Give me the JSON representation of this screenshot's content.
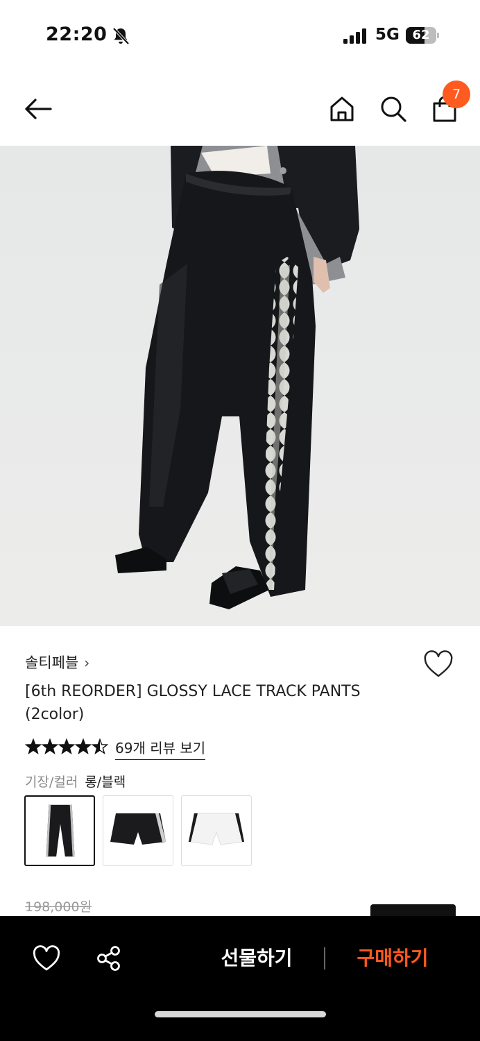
{
  "status_bar": {
    "time": "22:20",
    "network": "5G",
    "battery": "62",
    "battery_level": 0.62
  },
  "nav": {
    "cart_count": "7",
    "icons": [
      "back-arrow-icon",
      "home-icon",
      "search-icon",
      "shopping-bag-icon"
    ],
    "badge_color": "#ff5a1f"
  },
  "product": {
    "brand": "솔티페블",
    "title": "[6th REORDER] GLOSSY LACE TRACK PANTS (2color)",
    "rating": 4.5,
    "review_link": "69개 리뷰 보기",
    "option_label": "기장/컬러",
    "option_value": "롱/블랙",
    "swatches": [
      {
        "name": "long-black",
        "selected": true
      },
      {
        "name": "short-black",
        "selected": false
      },
      {
        "name": "short-white",
        "selected": false
      }
    ],
    "original_price": "198,000원"
  },
  "bottom_bar": {
    "gift_label": "선물하기",
    "buy_label": "구매하기",
    "accent_color": "#ff5a1f"
  }
}
